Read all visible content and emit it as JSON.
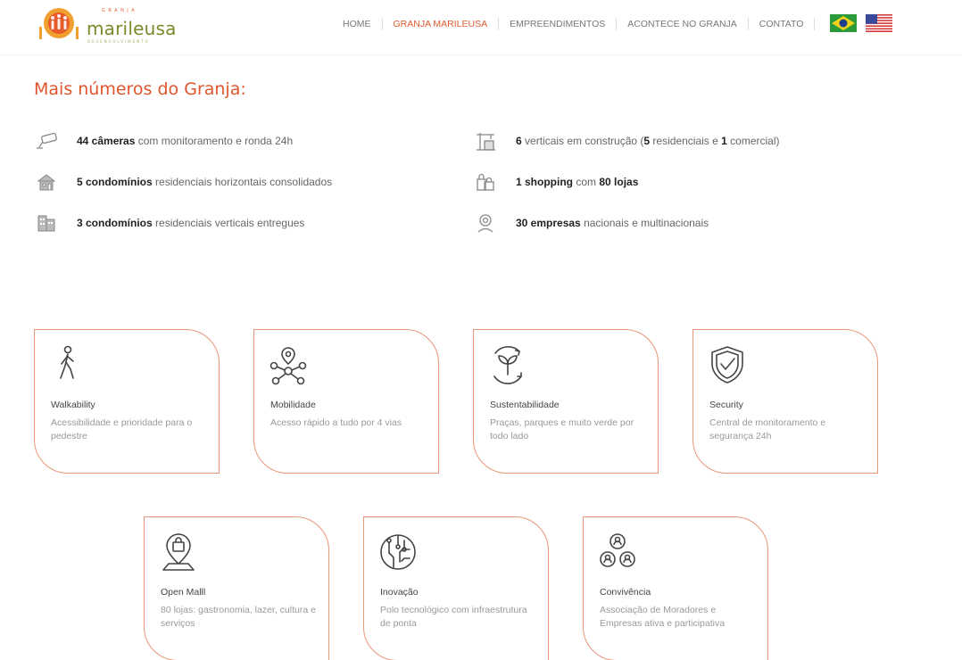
{
  "brand": {
    "top": "GRANJA",
    "name": "marileusa",
    "bottom": "DESENVOLVIMENTO",
    "primary_color": "#e0552c",
    "secondary_color": "#7a8a2a"
  },
  "nav": {
    "items": [
      {
        "label": "HOME"
      },
      {
        "label": "GRANJA MARILEUSA",
        "active": true
      },
      {
        "label": "EMPREENDIMENTOS"
      },
      {
        "label": "ACONTECE NO GRANJA"
      },
      {
        "label": "CONTATO"
      }
    ],
    "flags": [
      "brazil-flag-icon",
      "usa-flag-icon"
    ]
  },
  "section_title": "Mais números do Granja:",
  "stats": [
    {
      "icon": "camera-icon",
      "strong": "44 câmeras",
      "rest": " com monitoramento e ronda 24h"
    },
    {
      "icon": "house-icon",
      "strong": "5 condomínios",
      "rest": " residenciais horizontais consolidados"
    },
    {
      "icon": "building-icon",
      "strong": "3 condomínios",
      "rest": " residenciais verticais entregues"
    },
    {
      "icon": "crane-icon",
      "strong": "6",
      "rest": " verticais em construção (",
      "strong2": "5",
      "rest2": " residenciais e ",
      "strong3": "1",
      "rest3": " comercial)"
    },
    {
      "icon": "shopping-bags-icon",
      "strong": "1 shopping",
      "rest": " com ",
      "strong2": "80 lojas",
      "rest2": ""
    },
    {
      "icon": "company-icon",
      "strong": "30 empresas",
      "rest": " nacionais e multinacionais"
    }
  ],
  "cards": [
    {
      "icon": "pedestrian-icon",
      "title": "Walkability",
      "desc": "Acessibilidade e prioridade para o pedestre"
    },
    {
      "icon": "location-network-icon",
      "title": "Mobilidade",
      "desc": "Acesso rápido a tudo por 4 vias"
    },
    {
      "icon": "sprout-icon",
      "title": "Sustentabilidade",
      "desc": "Praças, parques e muito verde por todo lado"
    },
    {
      "icon": "shield-check-icon",
      "title": "Security",
      "desc": "Central de monitoramento e segurança 24h"
    },
    {
      "icon": "shopping-pin-icon",
      "title": "Open Malll",
      "desc": "80 lojas: gastronomia, lazer, cultura e serviços"
    },
    {
      "icon": "circuit-icon",
      "title": "Inovação",
      "desc": "Polo tecnológico com infraestrutura de ponta"
    },
    {
      "icon": "community-icon",
      "title": "Convivência",
      "desc": "Associação de Moradores e Empresas ativa e participativa"
    }
  ]
}
